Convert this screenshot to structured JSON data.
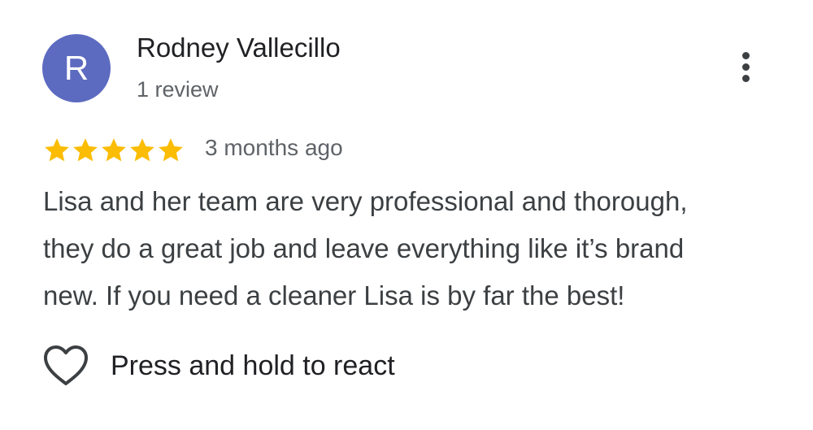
{
  "reviewer": {
    "initial": "R",
    "name": "Rodney Vallecillo",
    "review_count": "1 review",
    "avatar_color": "#5c6bc0"
  },
  "more_options": {
    "icon": "more-vertical-icon"
  },
  "rating": {
    "stars": 5,
    "max_stars": 5,
    "star_color": "#fbbc04",
    "date": "3 months ago"
  },
  "review": {
    "lines": [
      "Lisa and her team are very professional and thorough,",
      "they do a great job and leave everything like it’s brand",
      "new. If you need a cleaner Lisa is by far the best!"
    ]
  },
  "reaction": {
    "icon": "heart-outline-icon",
    "label": "Press and hold to react"
  }
}
